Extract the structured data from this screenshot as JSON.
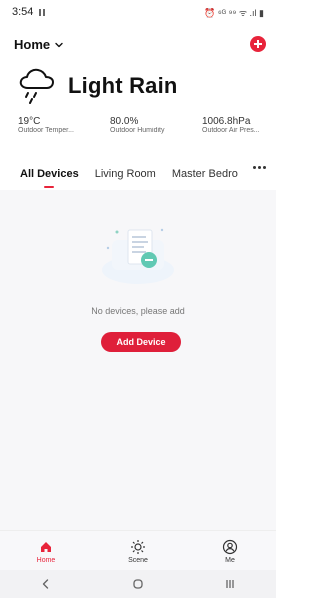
{
  "status_bar": {
    "time": "3:54",
    "right_icons_text": "⏰ ⁶ᴳ ⁹⁹ ᯤ .ıl ▮"
  },
  "header": {
    "title": "Home"
  },
  "weather": {
    "condition": "Light Rain",
    "stats": [
      {
        "value": "19°C",
        "label": "Outdoor Temper..."
      },
      {
        "value": "80.0%",
        "label": "Outdoor Humidity"
      },
      {
        "value": "1006.8hPa",
        "label": "Outdoor Air Pres..."
      }
    ]
  },
  "tabs": [
    {
      "label": "All Devices",
      "active": true
    },
    {
      "label": "Living Room",
      "active": false
    },
    {
      "label": "Master Bedro",
      "active": false
    }
  ],
  "empty_state": {
    "message": "No devices, please add",
    "button_label": "Add Device"
  },
  "bottom_nav": [
    {
      "label": "Home",
      "icon": "home-icon",
      "active": true
    },
    {
      "label": "Scene",
      "icon": "sun-icon",
      "active": false
    },
    {
      "label": "Me",
      "icon": "profile-icon",
      "active": false
    }
  ],
  "colors": {
    "accent": "#e8243b",
    "background": "#f7f7f9",
    "text": "#111111"
  }
}
